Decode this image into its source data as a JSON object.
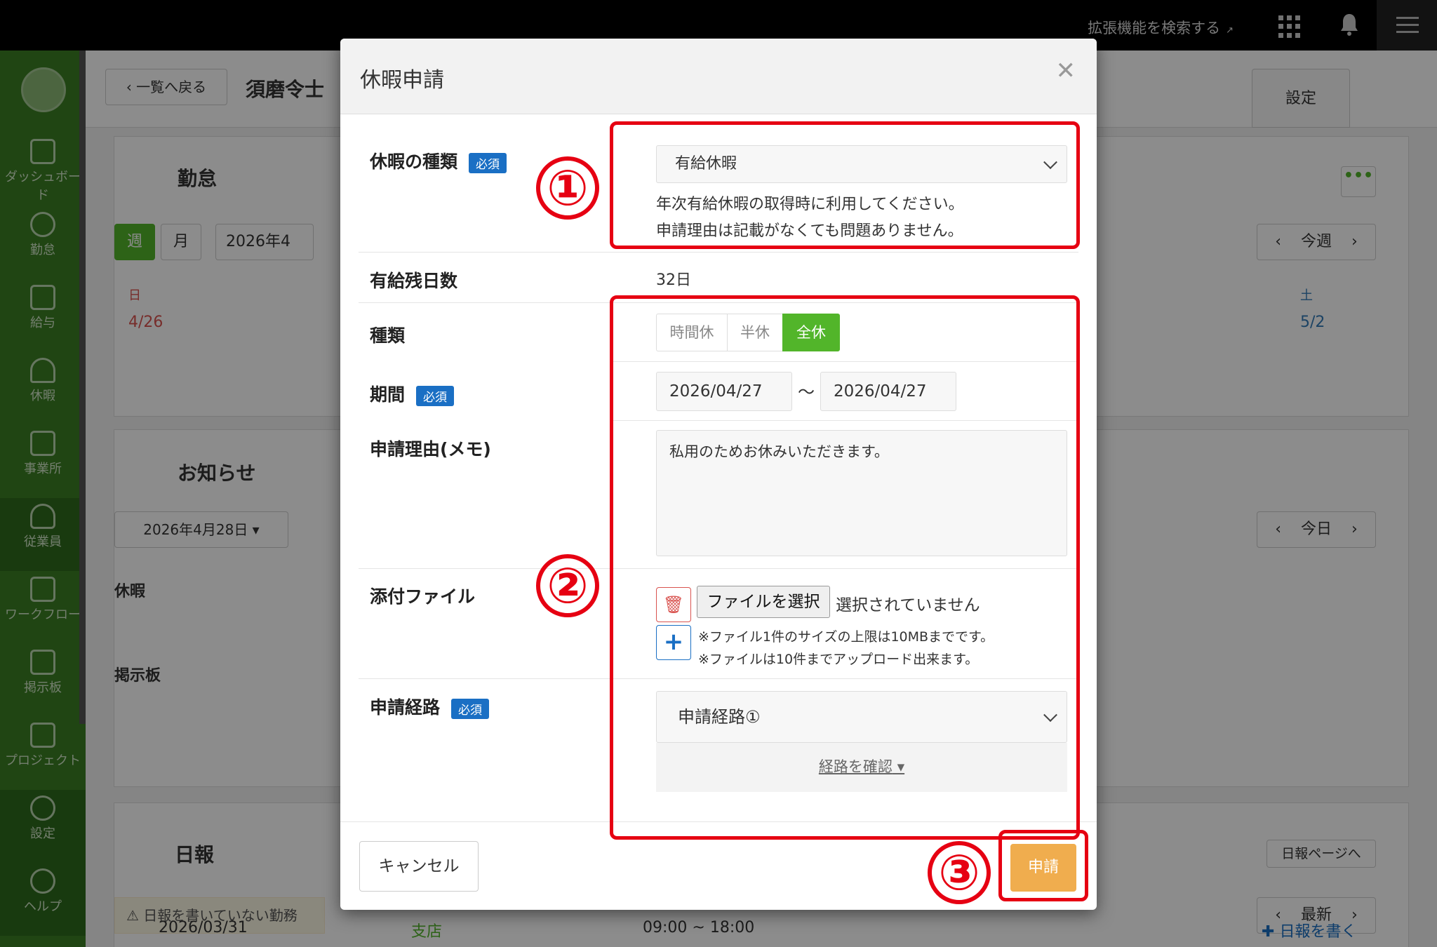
{
  "topbar": {
    "search_ext": "拡張機能を検索する"
  },
  "sidebar": {
    "items": [
      {
        "label": "ダッシュボード",
        "icon": "dashboard-icon"
      },
      {
        "label": "勤怠",
        "icon": "clock-icon"
      },
      {
        "label": "給与",
        "icon": "calculator-icon"
      },
      {
        "label": "休暇",
        "icon": "umbrella-icon"
      },
      {
        "label": "事業所",
        "icon": "home-icon"
      },
      {
        "label": "従業員",
        "icon": "user-icon"
      },
      {
        "label": "ワークフロー",
        "icon": "workflow-icon"
      },
      {
        "label": "掲示板",
        "icon": "chat-icon"
      },
      {
        "label": "プロジェクト",
        "icon": "flag-icon"
      },
      {
        "label": "設定",
        "icon": "gear-icon"
      },
      {
        "label": "ヘルプ",
        "icon": "help-icon"
      }
    ]
  },
  "page": {
    "back_label": "一覧へ戻る",
    "employee_name": "須磨令士",
    "settings_tab": "設定",
    "attendance_title": "勤怠",
    "week_btn": "週",
    "month_btn": "月",
    "date_range": "2026年4",
    "this_week": "今週",
    "sun_label": "日",
    "sat_label": "土",
    "sun_date": "4/26",
    "sat_date": "5/2",
    "news_title": "お知らせ",
    "news_date": "2026年4月28日",
    "today_btn": "今日",
    "leave_section": "休暇",
    "board_section": "掲示板",
    "daily_title": "日報",
    "daily_page_btn": "日報ページへ",
    "daily_warning": "日報を書いていない勤務",
    "latest_btn": "最新",
    "row_date": "2026/03/31",
    "row_branch": "支店",
    "row_time": "09:00 ~ 18:00",
    "write_daily": "日報を書く"
  },
  "modal": {
    "title": "休暇申請",
    "required_badge": "必須",
    "leave_type_label": "休暇の種類",
    "leave_type_value": "有給休暇",
    "leave_help_1": "年次有給休暇の取得時に利用してください。",
    "leave_help_2": "申請理由は記載がなくても問題ありません。",
    "paid_remaining_label": "有給残日数",
    "paid_remaining_value": "32日",
    "kind_label": "種類",
    "kind_options": [
      "時間休",
      "半休",
      "全休"
    ],
    "kind_selected": "全休",
    "period_label": "期間",
    "period_start": "2026/04/27",
    "period_sep": "〜",
    "period_end": "2026/04/27",
    "reason_label": "申請理由(メモ)",
    "reason_value": "私用のためお休みいただきます。",
    "attach_label": "添付ファイル",
    "file_button": "ファイルを選択",
    "file_status": "選択されていません",
    "file_note_1": "※ファイル1件のサイズの上限は10MBまでです。",
    "file_note_2": "※ファイルは10件までアップロード出来ます。",
    "route_label": "申請経路",
    "route_value": "申請経路①",
    "route_check": "経路を確認",
    "cancel": "キャンセル",
    "submit": "申請"
  },
  "annotations": [
    "①",
    "②",
    "③"
  ],
  "colors": {
    "brand_green": "#3b7f24",
    "accent_orange": "#f0ad4e",
    "required_blue": "#1a6fc4",
    "annotation_red": "#e60012",
    "selected_green": "#52b52a"
  }
}
